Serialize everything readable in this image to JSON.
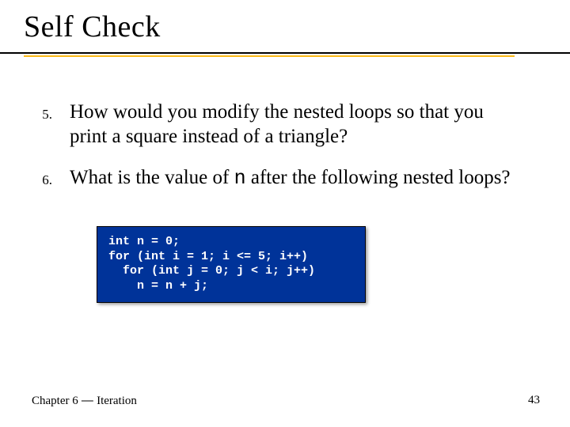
{
  "title": "Self Check",
  "questions": [
    {
      "number": "5.",
      "text": "How would you modify the nested loops so that you print a square instead of a triangle?"
    },
    {
      "number": "6.",
      "text_before": "What is the value of ",
      "code_var": "n",
      "text_after": " after the following nested loops?"
    }
  ],
  "code_block": "int n = 0;\nfor (int i = 1; i <= 5; i++)\n  for (int j = 0; j < i; j++)\n    n = n + j;",
  "footer": {
    "chapter_prefix": "Chapter 6",
    "chapter_sep": " — ",
    "chapter_topic": "Iteration",
    "page": "43"
  }
}
